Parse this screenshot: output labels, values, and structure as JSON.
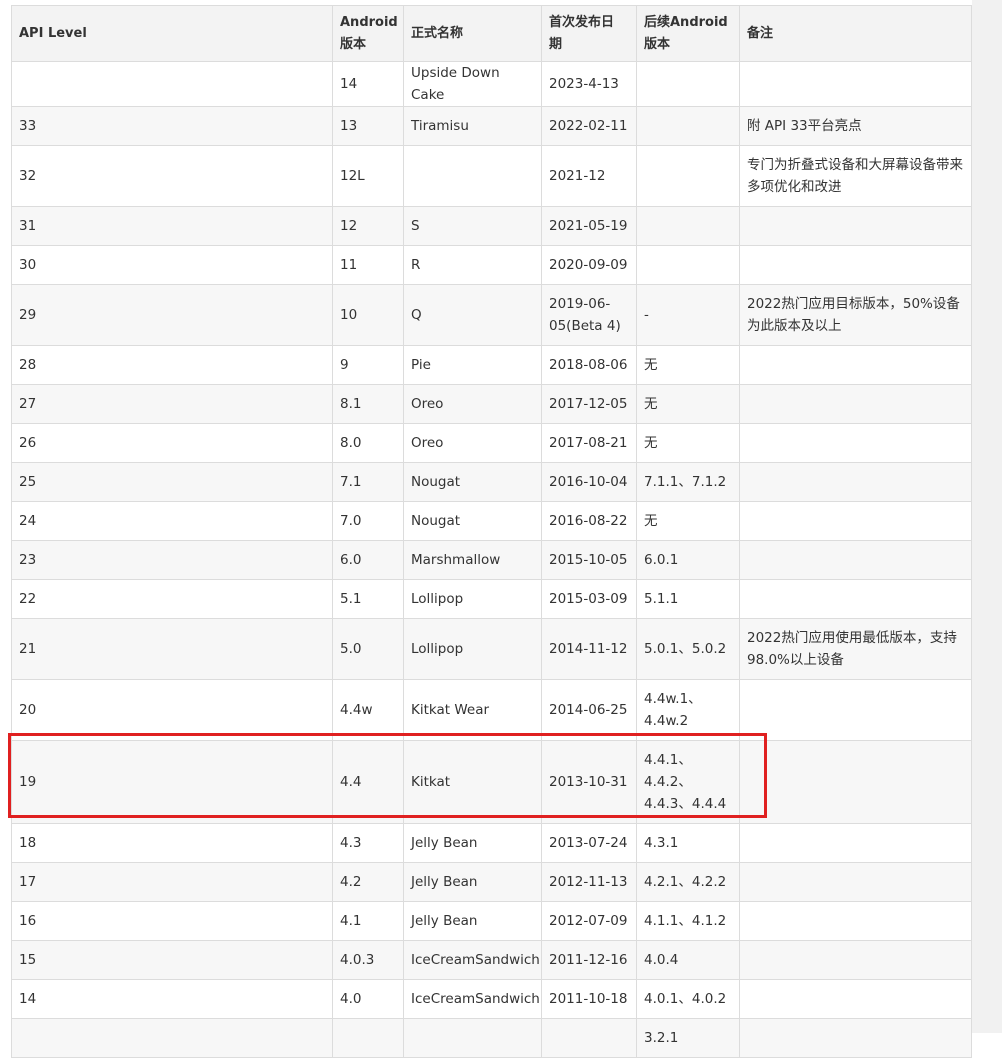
{
  "table": {
    "headers": [
      "API Level",
      "Android\n版本",
      "正式名称",
      "首次发布日\n期",
      "后续Android\n版本",
      "备注"
    ],
    "rows": [
      {
        "api": "",
        "version": "14",
        "name": "Upside Down Cake",
        "date": "2023-4-13",
        "later": "",
        "note": "",
        "h": "one-line"
      },
      {
        "api": "33",
        "version": "13",
        "name": "Tiramisu",
        "date": "2022-02-11",
        "later": "",
        "note": "附 API 33平台亮点",
        "h": "one-line"
      },
      {
        "api": "32",
        "version": "12L",
        "name": "",
        "date": "2021-12",
        "later": "",
        "note": "专门为折叠式设备和大屏幕设备带来多项优化和改进",
        "h": "two-line"
      },
      {
        "api": "31",
        "version": "12",
        "name": "S",
        "date": "2021-05-19",
        "later": "",
        "note": "",
        "h": "one-line"
      },
      {
        "api": "30",
        "version": "11",
        "name": "R",
        "date": "2020-09-09",
        "later": "",
        "note": "",
        "h": "one-line"
      },
      {
        "api": "29",
        "version": "10",
        "name": "Q",
        "date": "2019-06-05(Beta 4)",
        "later": "-",
        "note": "2022热门应用目标版本，50%设备为此版本及以上",
        "h": "two-line"
      },
      {
        "api": "28",
        "version": "9",
        "name": "Pie",
        "date": "2018-08-06",
        "later": "无",
        "note": "",
        "h": "one-line"
      },
      {
        "api": "27",
        "version": "8.1",
        "name": "Oreo",
        "date": "2017-12-05",
        "later": "无",
        "note": "",
        "h": "one-line"
      },
      {
        "api": "26",
        "version": "8.0",
        "name": "Oreo",
        "date": "2017-08-21",
        "later": "无",
        "note": "",
        "h": "one-line"
      },
      {
        "api": "25",
        "version": "7.1",
        "name": "Nougat",
        "date": "2016-10-04",
        "later": "7.1.1、7.1.2",
        "note": "",
        "h": "one-line"
      },
      {
        "api": "24",
        "version": "7.0",
        "name": "Nougat",
        "date": "2016-08-22",
        "later": "无",
        "note": "",
        "h": "one-line"
      },
      {
        "api": "23",
        "version": "6.0",
        "name": "Marshmallow",
        "date": "2015-10-05",
        "later": "6.0.1",
        "note": "",
        "h": "one-line"
      },
      {
        "api": "22",
        "version": "5.1",
        "name": "Lollipop",
        "date": "2015-03-09",
        "later": "5.1.1",
        "note": "",
        "h": "one-line"
      },
      {
        "api": "21",
        "version": "5.0",
        "name": "Lollipop",
        "date": "2014-11-12",
        "later": "5.0.1、5.0.2",
        "note": "2022热门应用使用最低版本，支持98.0%以上设备",
        "h": "two-line"
      },
      {
        "api": "20",
        "version": "4.4w",
        "name": "Kitkat Wear",
        "date": "2014-06-25",
        "later": "4.4w.1、4.4w.2",
        "note": "",
        "h": "two-line"
      },
      {
        "api": "19",
        "version": "4.4",
        "name": "Kitkat",
        "date": "2013-10-31",
        "later": "4.4.1、4.4.2、4.4.3、4.4.4",
        "note": "",
        "h": "three-line"
      },
      {
        "api": "18",
        "version": "4.3",
        "name": "Jelly Bean",
        "date": "2013-07-24",
        "later": "4.3.1",
        "note": "",
        "h": "one-line"
      },
      {
        "api": "17",
        "version": "4.2",
        "name": "Jelly Bean",
        "date": "2012-11-13",
        "later": "4.2.1、4.2.2",
        "note": "",
        "h": "one-line"
      },
      {
        "api": "16",
        "version": "4.1",
        "name": "Jelly Bean",
        "date": "2012-07-09",
        "later": "4.1.1、4.1.2",
        "note": "",
        "h": "one-line"
      },
      {
        "api": "15",
        "version": "4.0.3",
        "name": "IceCreamSandwich",
        "date": "2011-12-16",
        "later": "4.0.4",
        "note": "",
        "h": "one-line"
      },
      {
        "api": "14",
        "version": "4.0",
        "name": "IceCreamSandwich",
        "date": "2011-10-18",
        "later": "4.0.1、4.0.2",
        "note": "",
        "h": "one-line"
      },
      {
        "api": "",
        "version": "",
        "name": "",
        "date": "",
        "later": "3.2.1",
        "note": "",
        "h": "one-line"
      }
    ],
    "highlighted_row_api": "19"
  },
  "colors": {
    "highlight_border": "#e02020",
    "header_bg": "#f3f3f3",
    "stripe_bg": "#f7f7f7",
    "border": "#dcdcdc"
  }
}
